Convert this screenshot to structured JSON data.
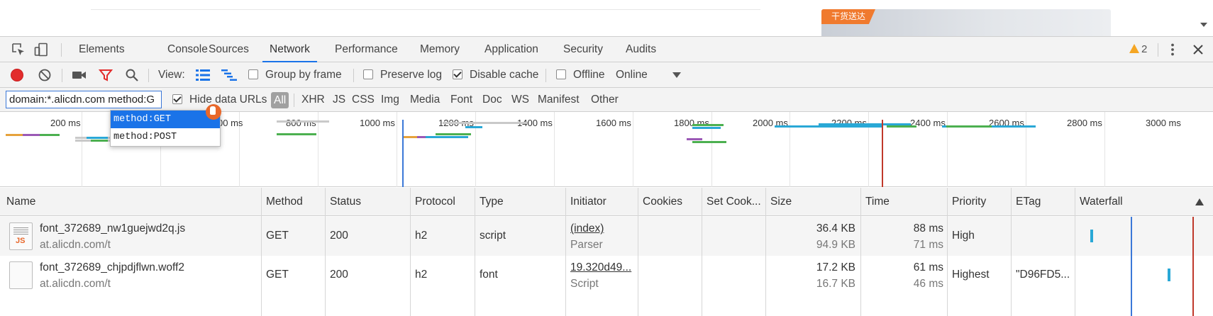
{
  "page": {
    "banner_tag": "干货送达",
    "colors": {
      "banner_tag": "#f07a2e"
    }
  },
  "devtools": {
    "tabs": [
      "Elements",
      "Console",
      "Sources",
      "Network",
      "Performance",
      "Memory",
      "Application",
      "Security",
      "Audits"
    ],
    "active_tab": "Network",
    "warnings_count": "2",
    "icons": [
      "inspect-element-icon",
      "device-toolbar-icon",
      "warning-icon",
      "more-vert-icon",
      "close-icon"
    ],
    "accent": "#1a73e8"
  },
  "toolbar": {
    "record_color": "#e22c2c",
    "view_label": "View:",
    "group_by_frame": {
      "label": "Group by frame",
      "checked": false
    },
    "preserve_log": {
      "label": "Preserve log",
      "checked": false
    },
    "disable_cache": {
      "label": "Disable cache",
      "checked": true
    },
    "offline": {
      "label": "Offline",
      "checked": false
    },
    "throttling": "Online"
  },
  "filter": {
    "value": "domain:*.alicdn.com method:G",
    "hide_data_urls": {
      "label": "Hide data URLs",
      "checked": true
    },
    "types": [
      "All",
      "XHR",
      "JS",
      "CSS",
      "Img",
      "Media",
      "Font",
      "Doc",
      "WS",
      "Manifest",
      "Other"
    ],
    "active_type": "All"
  },
  "autocomplete": {
    "items": [
      "method:GET",
      "method:POST"
    ],
    "selected": "method:GET"
  },
  "overview": {
    "ticks": [
      "200 ms",
      "00 ms",
      "800 ms",
      "1000 ms",
      "1200 ms",
      "1400 ms",
      "1600 ms",
      "1800 ms",
      "2000 ms",
      "2200 ms",
      "2400 ms",
      "2600 ms",
      "2800 ms",
      "3000 ms"
    ],
    "dom_content_loaded_color": "#3b78d8",
    "load_color": "#c0392b"
  },
  "table": {
    "columns": [
      "Name",
      "Method",
      "Status",
      "Protocol",
      "Type",
      "Initiator",
      "Cookies",
      "Set Cook...",
      "Size",
      "Time",
      "Priority",
      "ETag",
      "Waterfall"
    ],
    "rows": [
      {
        "name": "font_372689_nw1guejwd2q.js",
        "domain": "at.alicdn.com/t",
        "icon": "js-file-icon",
        "method": "GET",
        "status": "200",
        "protocol": "h2",
        "type": "script",
        "initiator": "(index)",
        "initiator_sub": "Parser",
        "cookies": "",
        "set_cookies": "",
        "size": "36.4 KB",
        "size_sub": "94.9 KB",
        "time": "88 ms",
        "time_sub": "71 ms",
        "priority": "High",
        "etag": ""
      },
      {
        "name": "font_372689_chjpdjflwn.woff2",
        "domain": "at.alicdn.com/t",
        "icon": "font-file-icon",
        "method": "GET",
        "status": "200",
        "protocol": "h2",
        "type": "font",
        "initiator": "19.320d49...",
        "initiator_sub": "Script",
        "cookies": "",
        "set_cookies": "",
        "size": "17.2 KB",
        "size_sub": "16.7 KB",
        "time": "61 ms",
        "time_sub": "46 ms",
        "priority": "Highest",
        "etag": "\"D96FD5..."
      }
    ]
  }
}
